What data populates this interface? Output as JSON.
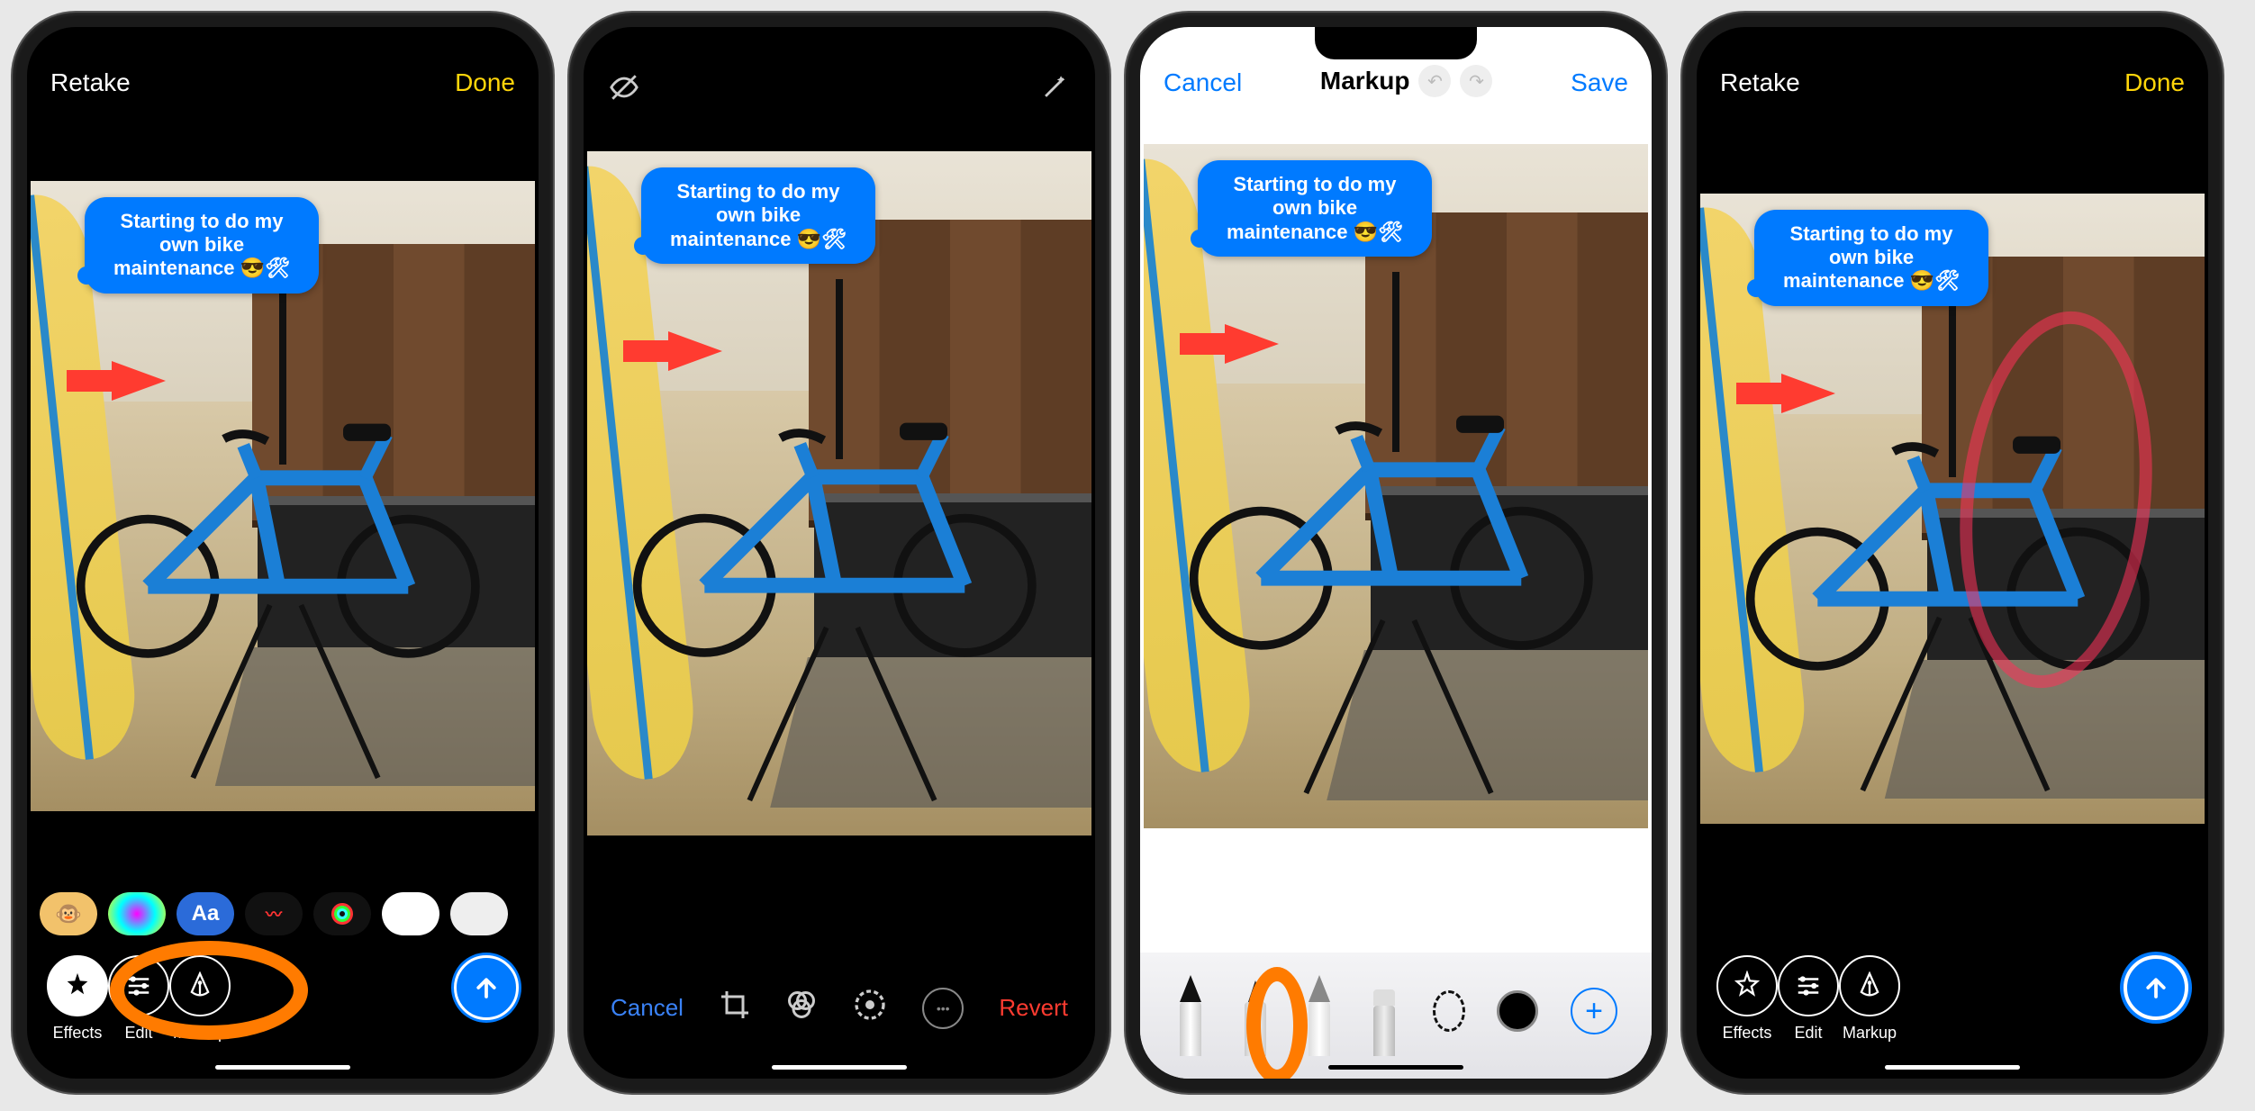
{
  "speech_text": "Starting to do my own bike maintenance 😎🛠",
  "screens": [
    {
      "id": "messages-photo-review-1",
      "top": {
        "left": "Retake",
        "right": "Done"
      },
      "apps": [
        {
          "name": "animoji",
          "label": "🐵",
          "data_name": "animoji-app-icon"
        },
        {
          "name": "filters",
          "label": "",
          "data_name": "filters-app-icon"
        },
        {
          "name": "text",
          "label": "Aa",
          "data_name": "text-app-icon"
        },
        {
          "name": "scribble",
          "label": "",
          "data_name": "digital-touch-app-icon"
        },
        {
          "name": "activity",
          "label": "",
          "data_name": "activity-app-icon"
        },
        {
          "name": "more1",
          "label": "",
          "data_name": "app-icon-6"
        },
        {
          "name": "more2",
          "label": "",
          "data_name": "app-icon-7"
        }
      ],
      "tools": {
        "effects": "Effects",
        "edit": "Edit",
        "markup": "Markup"
      },
      "highlight": "edit-and-markup"
    },
    {
      "id": "photos-edit",
      "top_icons": {
        "left": "hide-icon",
        "right": "magic-wand-icon"
      },
      "editbar": {
        "cancel": "Cancel",
        "revert": "Revert",
        "icons": [
          "crop-icon",
          "filters-icon",
          "adjust-icon",
          "more-icon"
        ]
      }
    },
    {
      "id": "markup-editor",
      "top": {
        "left": "Cancel",
        "center": "Markup",
        "right": "Save"
      },
      "undo_enabled": false,
      "redo_enabled": false,
      "tools": [
        "pen",
        "marker",
        "pencil",
        "eraser",
        "lasso"
      ],
      "color": "#000000",
      "highlight": "marker-tool"
    },
    {
      "id": "messages-photo-review-2",
      "top": {
        "left": "Retake",
        "right": "Done"
      },
      "tools": {
        "effects": "Effects",
        "edit": "Edit",
        "markup": "Markup"
      },
      "has_drawing": true
    }
  ]
}
